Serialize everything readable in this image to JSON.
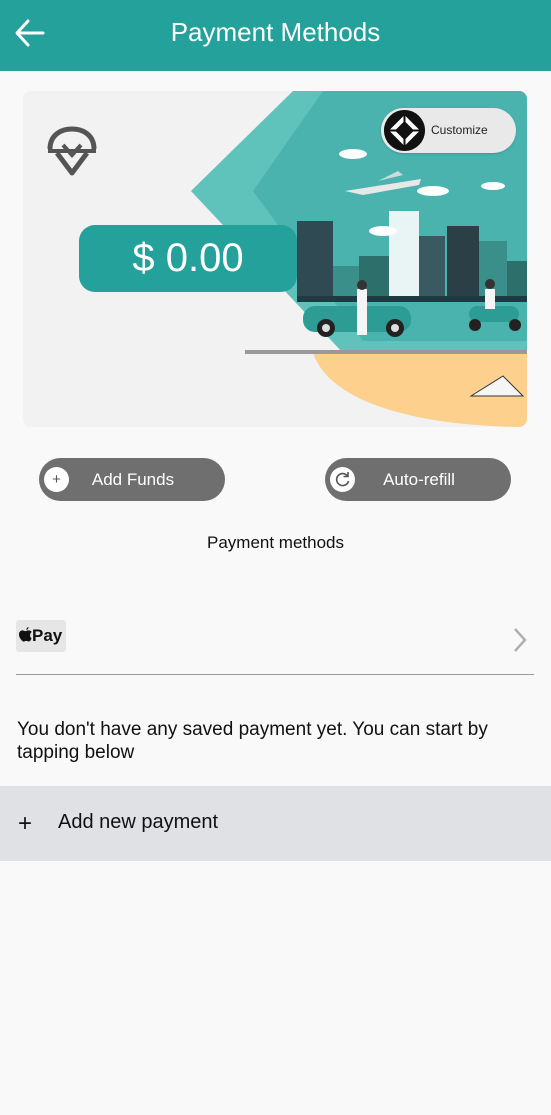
{
  "header": {
    "title": "Payment Methods",
    "back_icon": "arrow-left-icon"
  },
  "card": {
    "balance": "$ 0.00",
    "customize_label": "Customize",
    "logo_icon": "brand-logo-icon"
  },
  "actions": {
    "add_funds_label": "Add Funds",
    "auto_refill_label": "Auto-refill"
  },
  "payment_methods": {
    "section_label": "Payment methods",
    "apple_pay_label": "Pay",
    "empty_message": "You don't have any saved payment yet. You can start by tapping below",
    "add_new_label": "Add new payment",
    "add_new_icon": "+"
  },
  "colors": {
    "primary": "#23a19a",
    "pill": "#6f6f6f",
    "add_row": "#e0e1e4"
  }
}
